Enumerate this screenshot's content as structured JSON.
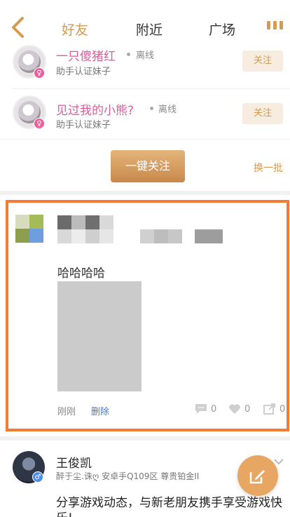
{
  "nav": {
    "tabs": [
      "好友",
      "附近",
      "广场"
    ],
    "active_tab": "好友"
  },
  "recommendations": [
    {
      "name": "一只傻猪红",
      "status": "离线",
      "subtitle": "助手认证妹子",
      "follow": "关注"
    },
    {
      "name": "见过我的小熊?",
      "status": "离线",
      "subtitle": "助手认证妹子",
      "follow": "关注"
    }
  ],
  "one_key_follow": "一键关注",
  "refresh": "换一批",
  "post": {
    "text": "哈哈哈哈",
    "time": "刚刚",
    "delete": "删除",
    "comments": "0",
    "likes": "0",
    "shares": "0"
  },
  "next_post": {
    "name": "王俊凯",
    "subtitle": "醉于尘.诛ღ 安卓手Q109区 尊贵铂金II",
    "body": "分享游戏动态，与新老朋友携手享受游戏快乐!"
  },
  "colors": {
    "accent": "#d49a4f",
    "highlight_border": "#f47b30",
    "pink_name": "#e05a9b",
    "link": "#4a79c8"
  }
}
